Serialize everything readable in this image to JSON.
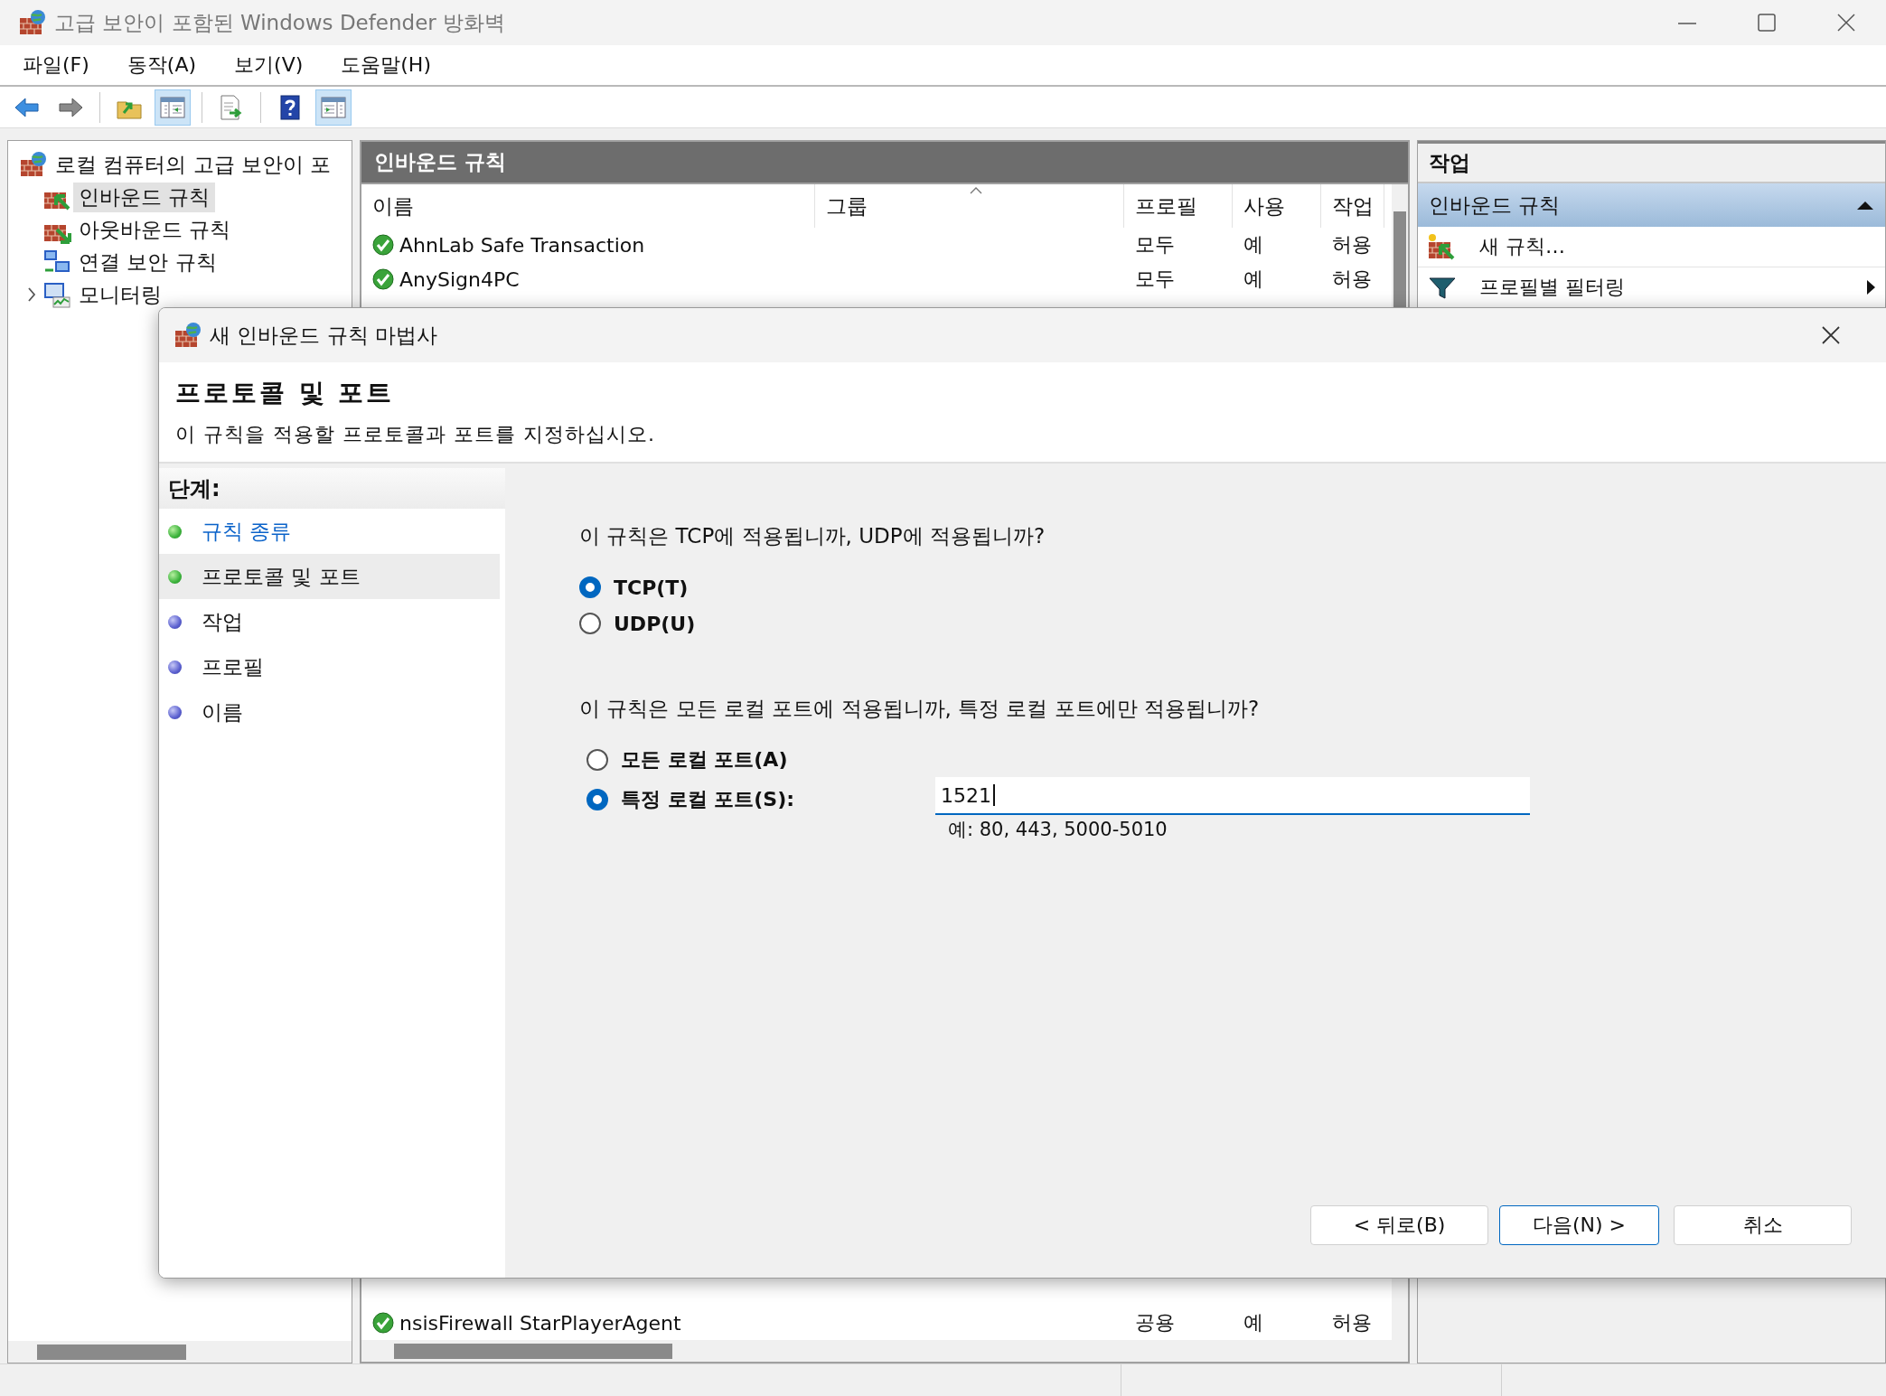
{
  "window": {
    "title": "고급 보안이 포함된 Windows Defender 방화벽"
  },
  "menu": [
    "파일(F)",
    "동작(A)",
    "보기(V)",
    "도움말(H)"
  ],
  "toolbar": [
    {
      "kind": "back",
      "pressed": false
    },
    {
      "kind": "forward",
      "pressed": false
    },
    {
      "kind": "separator"
    },
    {
      "kind": "up",
      "pressed": false
    },
    {
      "kind": "console-tree",
      "pressed": true
    },
    {
      "kind": "separator"
    },
    {
      "kind": "export",
      "pressed": false
    },
    {
      "kind": "separator"
    },
    {
      "kind": "help",
      "pressed": false
    },
    {
      "kind": "action-pane",
      "pressed": true
    }
  ],
  "tree": {
    "label": "로컬 컴퓨터의 고급 보안이 포",
    "kind": "firewall",
    "selected": false,
    "children": [
      {
        "label": "인바운드 규칙",
        "kind": "inbound",
        "selected": true,
        "expandable": false
      },
      {
        "label": "아웃바운드 규칙",
        "kind": "outbound",
        "selected": false,
        "expandable": false
      },
      {
        "label": "연결 보안 규칙",
        "kind": "connection",
        "selected": false,
        "expandable": false
      },
      {
        "label": "모니터링",
        "kind": "monitor",
        "selected": false,
        "expandable": true
      }
    ]
  },
  "rules_panel": {
    "title": "인바운드 규칙",
    "columns": [
      {
        "label": "이름",
        "sorted": false
      },
      {
        "label": "그룹",
        "sorted": true
      },
      {
        "label": "프로필",
        "sorted": false
      },
      {
        "label": "사용",
        "sorted": false
      },
      {
        "label": "작업",
        "sorted": false
      }
    ],
    "rows": [
      {
        "kind": "allow",
        "name": "AhnLab Safe Transaction",
        "profile": "모두",
        "enabled": "예",
        "action": "허용"
      },
      {
        "kind": "allow",
        "name": "AnySign4PC",
        "profile": "모두",
        "enabled": "예",
        "action": "허용"
      }
    ],
    "last_rows": [
      {
        "kind": "allow",
        "name": "nsisFirewall StarPlayerAgent",
        "profile": "공용",
        "enabled": "예",
        "action": "허용"
      }
    ]
  },
  "actions": {
    "title": "작업",
    "section": {
      "label": "인바운드 규칙",
      "expanded": true
    },
    "items": [
      {
        "kind": "new-rule",
        "label": "새 규칙…",
        "submenu": false
      },
      {
        "kind": "filter",
        "label": "프로필별 필터링",
        "submenu": true
      }
    ]
  },
  "dialog": {
    "title": "새 인바운드 규칙 마법사",
    "heading": "프로토콜 및 포트",
    "subtitle": "이 규칙을 적용할 프로토콜과 포트를 지정하십시오.",
    "steps_title": "단계:",
    "steps": [
      {
        "label": "규칙 종류",
        "completed": true,
        "selected": false
      },
      {
        "label": "프로토콜 및 포트",
        "completed": true,
        "selected": true
      },
      {
        "label": "작업",
        "completed": false,
        "selected": false
      },
      {
        "label": "프로필",
        "completed": false,
        "selected": false
      },
      {
        "label": "이름",
        "completed": false,
        "selected": false
      }
    ],
    "protocol_question": "이 규칙은 TCP에 적용됩니까, UDP에 적용됩니까?",
    "protocol_options": [
      {
        "label": "TCP(T)",
        "selected": true
      },
      {
        "label": "UDP(U)",
        "selected": false
      }
    ],
    "port_question": "이 규칙은 모든 로컬 포트에 적용됩니까, 특정 로컬 포트에만 적용됩니까?",
    "port_options": [
      {
        "label": "모든 로컬 포트(A)",
        "selected": false
      },
      {
        "label": "특정 로컬 포트(S):",
        "selected": true,
        "field": {
          "value": "1521",
          "hint": "예: 80, 443, 5000-5010"
        }
      }
    ],
    "buttons": [
      {
        "label": "< 뒤로(B)",
        "default": false
      },
      {
        "label": "다음(N) >",
        "default": true
      },
      {
        "label": "취소",
        "default": false
      }
    ]
  }
}
